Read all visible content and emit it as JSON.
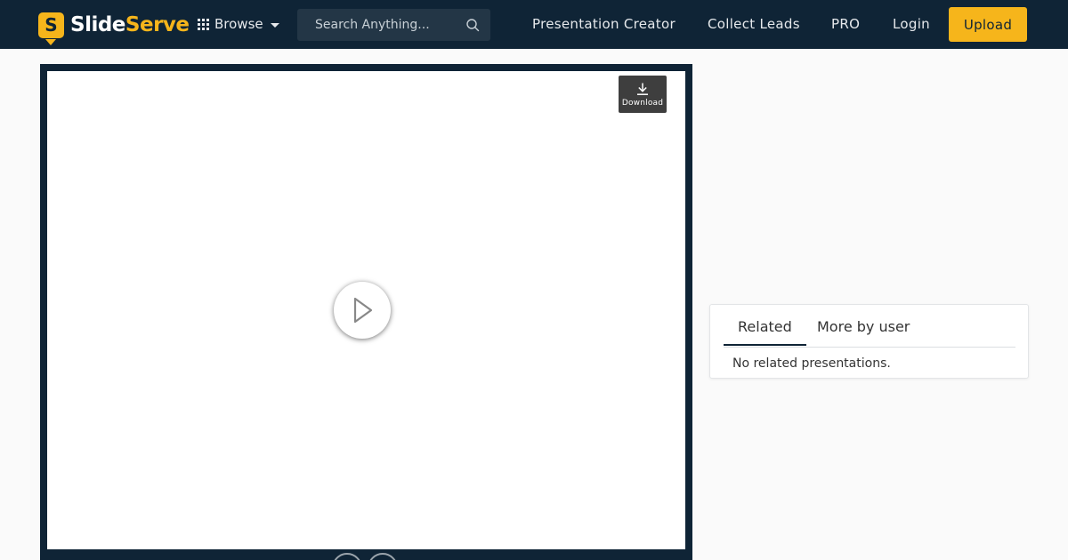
{
  "header": {
    "logo": {
      "part1": "Slide",
      "part2": "Serve",
      "badge_letter": "S"
    },
    "browse_label": "Browse",
    "search": {
      "placeholder": "Search Anything..."
    },
    "nav": [
      {
        "label": "Presentation Creator"
      },
      {
        "label": "Collect Leads"
      },
      {
        "label": "PRO"
      },
      {
        "label": "Login"
      }
    ],
    "upload_label": "Upload"
  },
  "viewer": {
    "download_label": "Download"
  },
  "related": {
    "tabs": [
      {
        "label": "Related",
        "active": true
      },
      {
        "label": "More by user",
        "active": false
      }
    ],
    "empty_message": "No related presentations."
  },
  "colors": {
    "brand_dark": "#0f2436",
    "accent": "#f6b51b",
    "download_bg": "#3e3e3e"
  },
  "icons": {
    "grid": "grid-icon",
    "caret": "chevron-down-icon",
    "search": "search-icon",
    "download": "download-icon",
    "play": "play-icon"
  }
}
